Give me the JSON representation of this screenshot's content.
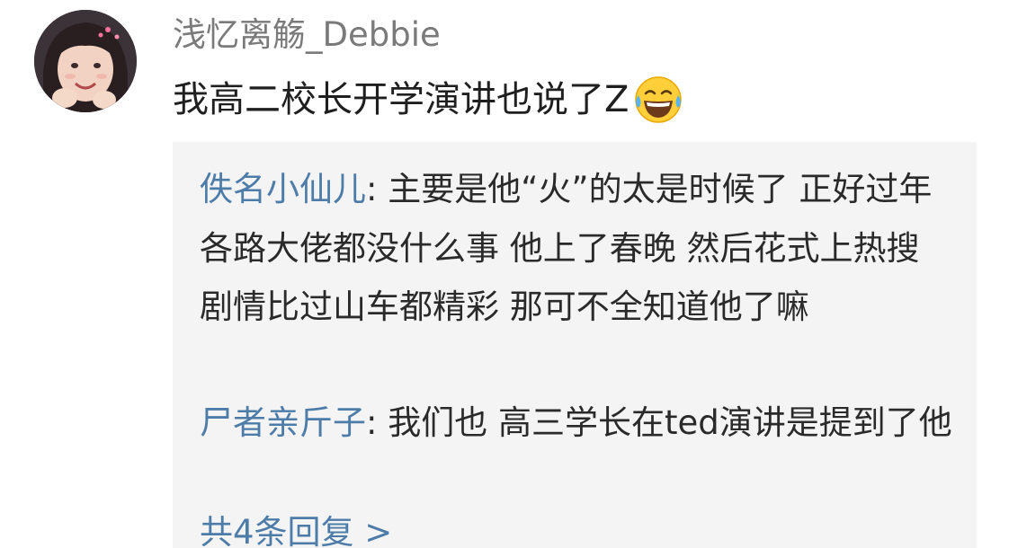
{
  "comment": {
    "username": "浅忆离觞_Debbie",
    "text": "我高二校长开学演讲也说了Z",
    "emoji": "tears-of-joy-emoji"
  },
  "replies": [
    {
      "author": "佚名小仙儿",
      "separator": ": ",
      "text": "主要是他“火”的太是时候了 正好过年 各路大佬都没什么事 他上了春晚 然后花式上热搜 剧情比过山车都精彩 那可不全知道他了嘛"
    },
    {
      "author": "尸者亲斤子",
      "separator": ": ",
      "text": "我们也 高三学长在ted演讲是提到了他"
    }
  ],
  "more_replies_label": "共4条回复 >",
  "colors": {
    "username": "#7a7a7a",
    "reply_author": "#4d7ca8",
    "reply_background": "#f4f4f4"
  }
}
